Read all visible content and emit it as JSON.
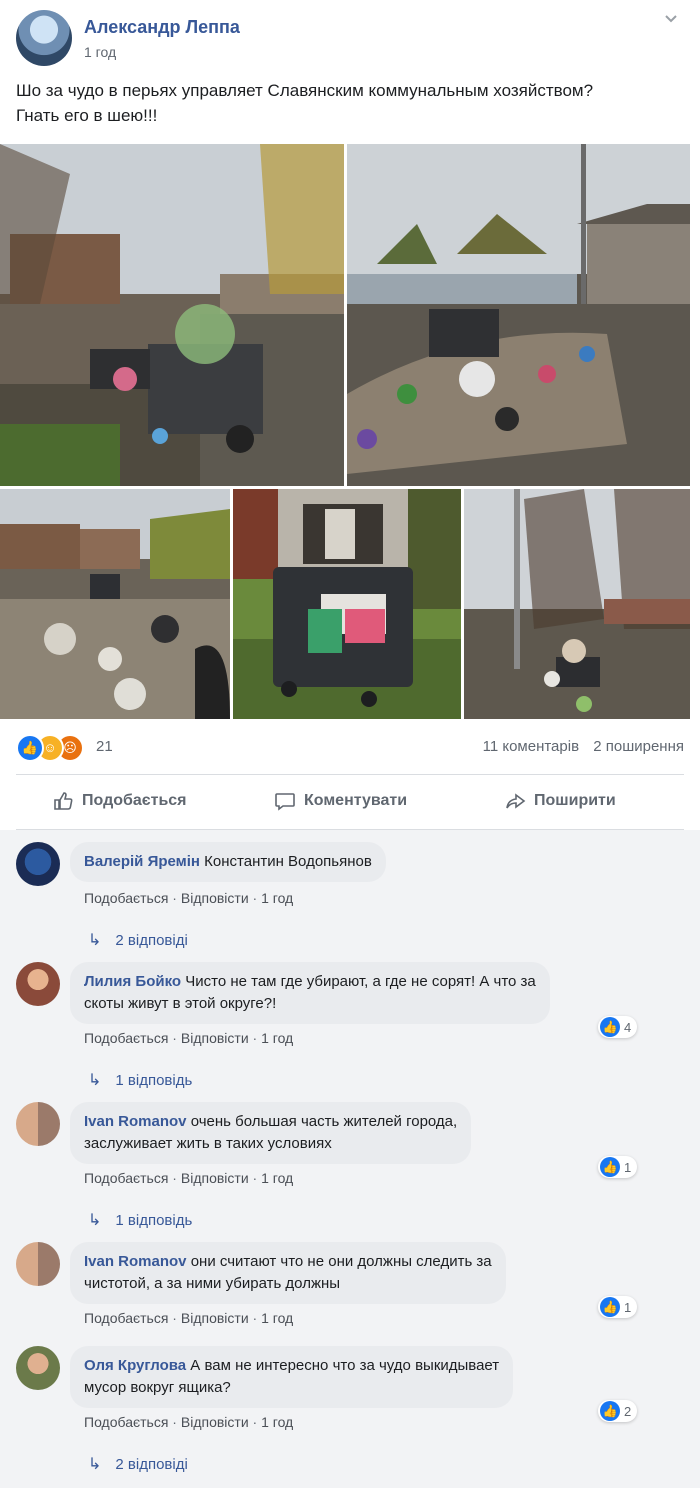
{
  "post": {
    "author": "Александр Леппа",
    "time": "1 год",
    "text_line1": "Шо за чудо в перьях управляет Славянским коммунальным хозяйством?",
    "text_line2": "Гнать его в шею!!!"
  },
  "stats": {
    "reaction_count": "21",
    "comments": "11 коментарів",
    "shares": "2 поширення"
  },
  "actions": {
    "like": "Подобається",
    "comment": "Коментувати",
    "share": "Поширити"
  },
  "comments": [
    {
      "name": "Валерій Яремін",
      "text": "Константин Водопьянов",
      "like_label": "Подобається",
      "reply_label": "Відповісти",
      "time": "1 год",
      "replies": "2 відповіді"
    },
    {
      "name": "Лилия Бойко",
      "text_line1": "Чисто не там где убирают, а где не сорят! А что за",
      "text_line2": "скоты живут в этой округе?!",
      "like_label": "Подобається",
      "reply_label": "Відповісти",
      "time": "1 год",
      "likes": "4",
      "replies": "1 відповідь"
    },
    {
      "name": "Ivan Romanov",
      "text_line1": "очень большая часть жителей города,",
      "text_line2": "заслуживает жить в таких условиях",
      "like_label": "Подобається",
      "reply_label": "Відповісти",
      "time": "1 год",
      "likes": "1",
      "replies": "1 відповідь"
    },
    {
      "name": "Ivan Romanov",
      "text_line1": "они считают что не они должны следить за",
      "text_line2": "чистотой, а за ними убирать должны",
      "like_label": "Подобається",
      "reply_label": "Відповісти",
      "time": "1 год",
      "likes": "1"
    },
    {
      "name": "Оля Круглова",
      "text_line1": "А вам не интересно что за чудо выкидывает",
      "text_line2": "мусор вокруг ящика?",
      "like_label": "Подобається",
      "reply_label": "Відповісти",
      "time": "1 год",
      "likes": "2",
      "replies": "2 відповіді"
    }
  ],
  "colors": {
    "link": "#385898",
    "like_blue": "#1877f2",
    "meta_gray": "#606770",
    "bubble": "#e9ebee"
  }
}
